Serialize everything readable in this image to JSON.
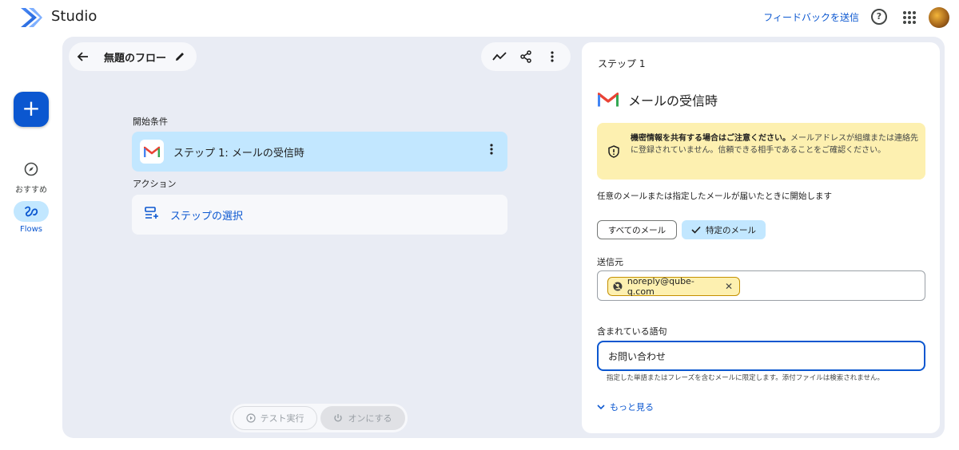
{
  "app": {
    "title": "Studio",
    "feedback_label": "フィードバックを送信",
    "help_glyph": "?"
  },
  "rail": {
    "create_glyph": "+",
    "items": [
      {
        "label": "おすすめ",
        "icon": "compass-icon"
      },
      {
        "label": "Flows",
        "icon": "flows-icon"
      }
    ]
  },
  "canvas": {
    "flow_title": "無題のフロー",
    "trigger_label": "開始条件",
    "step_label": "ステップ 1: メールの受信時",
    "action_label": "アクション",
    "choose_step_label": "ステップの選択",
    "test_run_label": "テスト実行",
    "turn_on_label": "オンにする"
  },
  "panel": {
    "step_title": "ステップ 1",
    "header": "メールの受信時",
    "warning_bold": "機密情報を共有する場合はご注意ください。",
    "warning_text": "メールアドレスが組織または連絡先に登録されていません。信頼できる相手であることをご確認ください。",
    "description": "任意のメールまたは指定したメールが届いたときに開始します",
    "option_all": "すべてのメール",
    "option_specific": "特定のメール",
    "sender_label": "送信元",
    "sender_email": "noreply@qube-q.com",
    "phrase_label": "含まれている語句",
    "phrase_value": "お問い合わせ",
    "hint": "指定した単語またはフレーズを含むメールに限定します。添付ファイルは検索されません。",
    "more_label": "もっと見る"
  },
  "colors": {
    "accent": "#0b57d0",
    "selected": "#c2e7ff",
    "warning": "#fdf0b0",
    "canvas": "#e9ecf4"
  }
}
